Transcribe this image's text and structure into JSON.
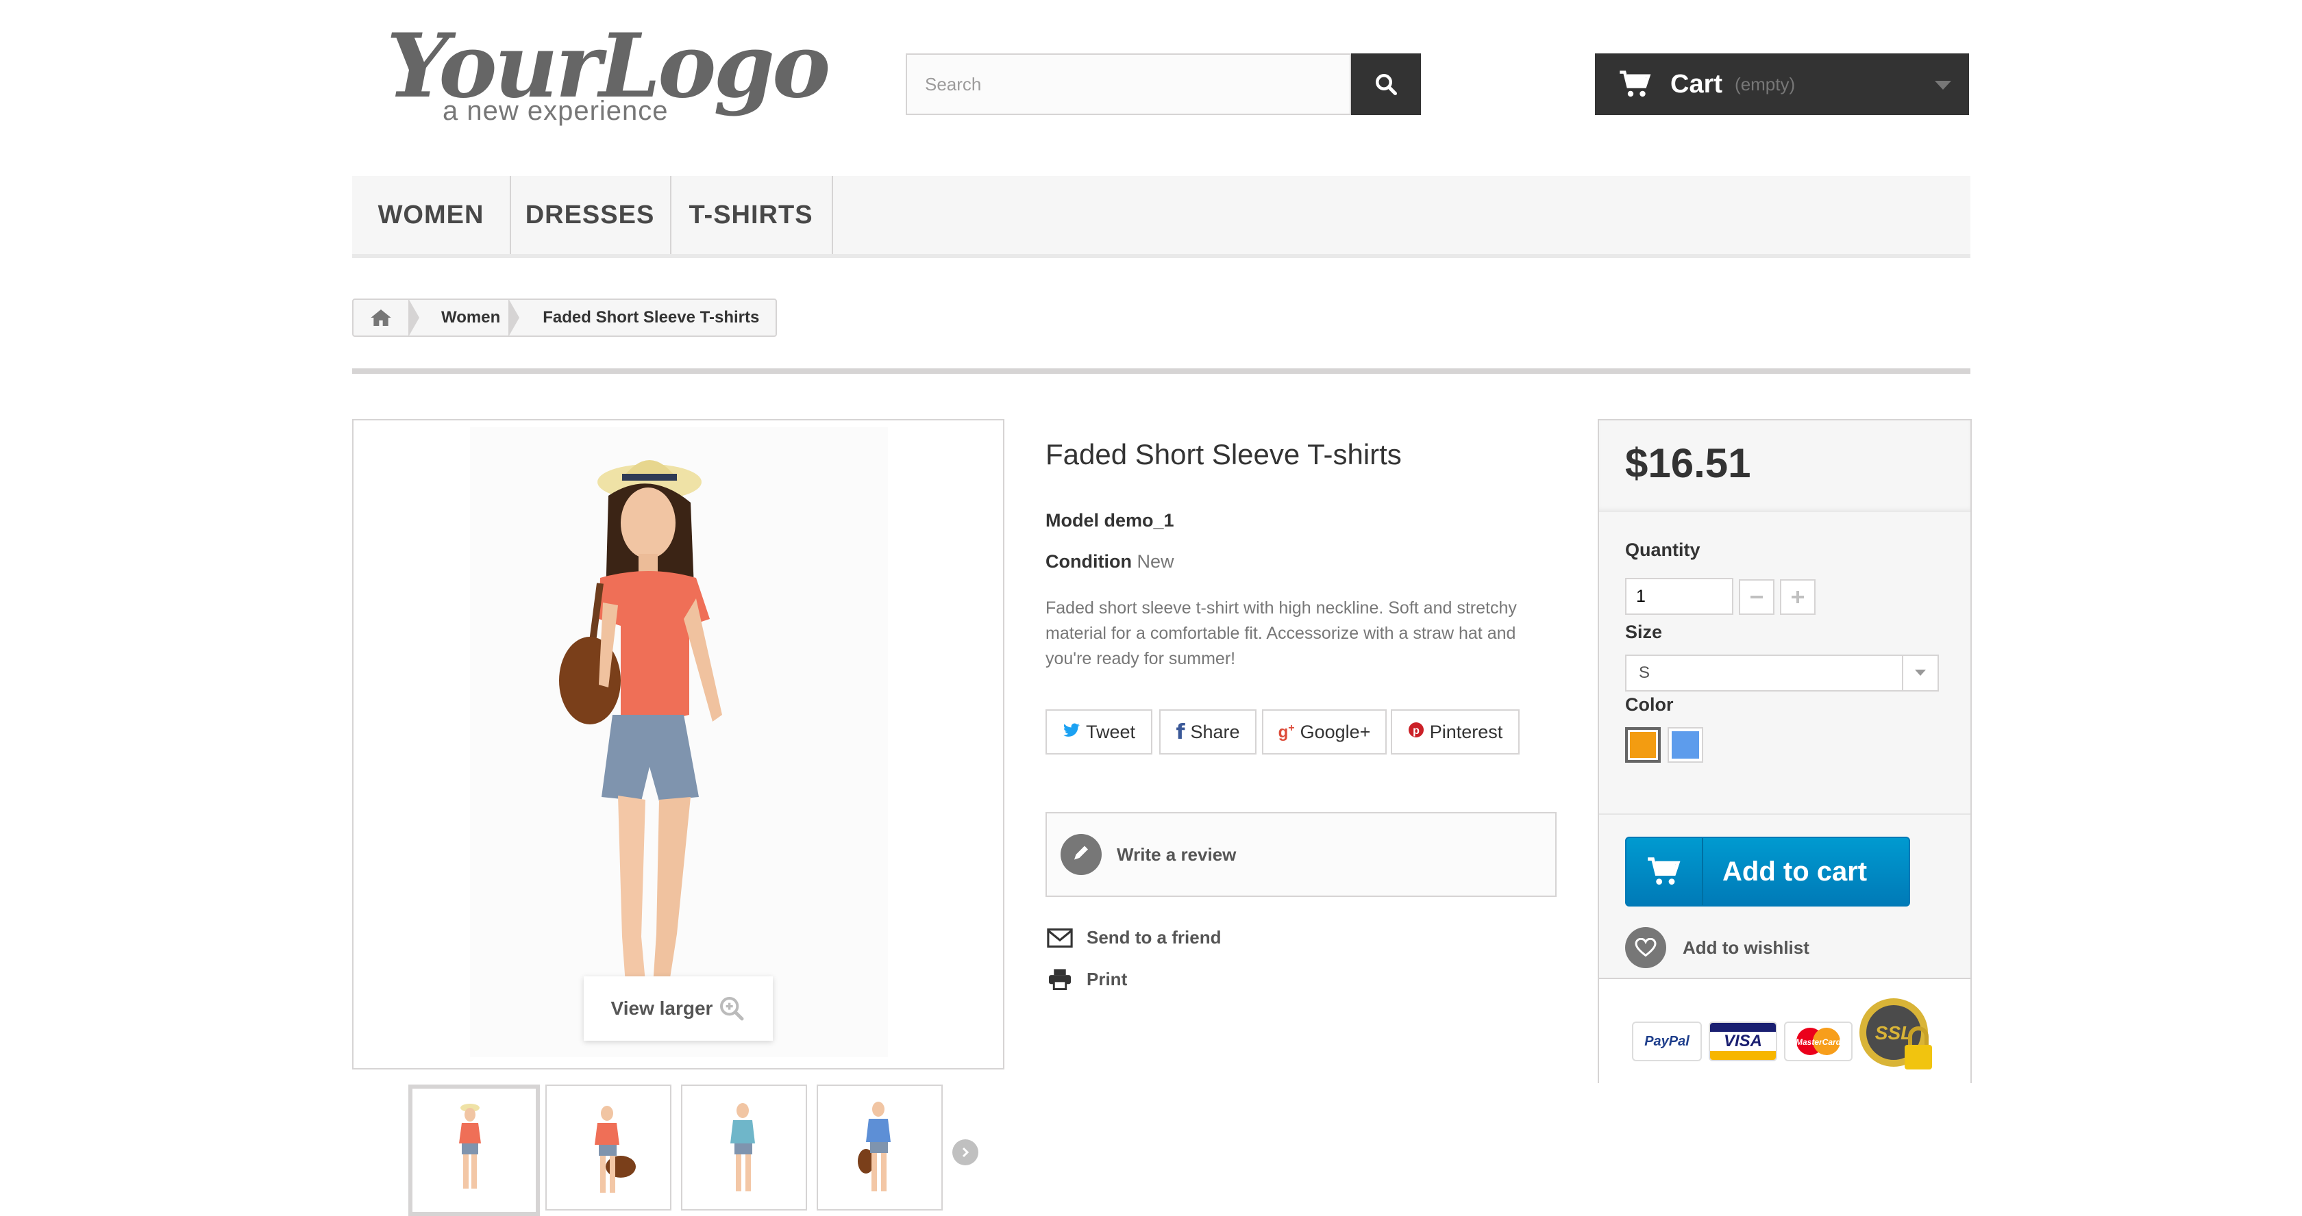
{
  "header": {
    "logo_main": "YourLogo",
    "logo_tagline": "a new experience",
    "search_placeholder": "Search",
    "cart_label": "Cart",
    "cart_status": "(empty)"
  },
  "menu": [
    {
      "label": "WOMEN"
    },
    {
      "label": "DRESSES"
    },
    {
      "label": "T-SHIRTS"
    }
  ],
  "breadcrumb": {
    "items": [
      "Women"
    ],
    "current": "Faded Short Sleeve T-shirts"
  },
  "gallery": {
    "view_larger": "View larger"
  },
  "product": {
    "title": "Faded Short Sleeve T-shirts",
    "model_label": "Model",
    "model_value": "demo_1",
    "condition_label": "Condition",
    "condition_value": "New",
    "description": "Faded short sleeve t-shirt with high neckline. Soft and stretchy material for a comfortable fit. Accessorize with a straw hat and you're ready for summer!"
  },
  "social": [
    {
      "label": "Tweet",
      "icon": "twitter-icon",
      "color": "#1ba1f2"
    },
    {
      "label": "Share",
      "icon": "facebook-icon",
      "color": "#3b5998"
    },
    {
      "label": "Google+",
      "icon": "google-plus-icon",
      "color": "#dd4b39"
    },
    {
      "label": "Pinterest",
      "icon": "pinterest-icon",
      "color": "#cb2027"
    }
  ],
  "actions": {
    "write_review": "Write a review",
    "send_friend": "Send to a friend",
    "print": "Print"
  },
  "buybox": {
    "price": "$16.51",
    "quantity_label": "Quantity",
    "quantity_value": "1",
    "size_label": "Size",
    "size_value": "S",
    "color_label": "Color",
    "colors": [
      "#f39c11",
      "#5d9cec"
    ],
    "add_to_cart": "Add to cart",
    "add_to_wishlist": "Add to wishlist"
  },
  "payment": {
    "paypal": "PayPal",
    "visa": "VISA",
    "mastercard": "MasterCard",
    "ssl": "SSL"
  }
}
